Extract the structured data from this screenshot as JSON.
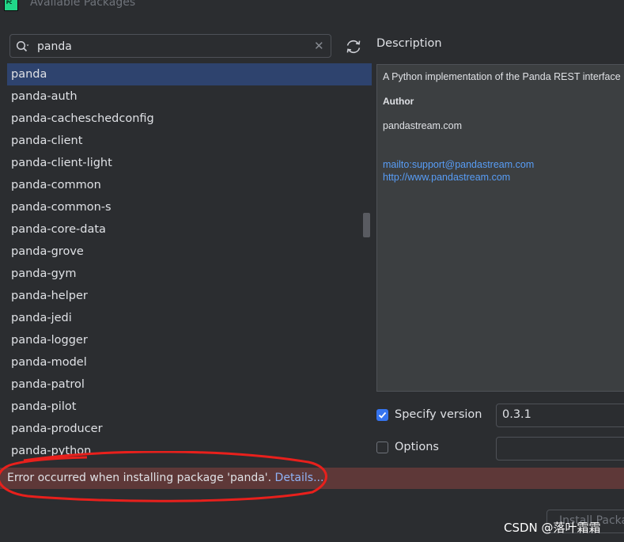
{
  "window": {
    "title": "Available Packages"
  },
  "search": {
    "value": "panda"
  },
  "packages": [
    "panda",
    "panda-auth",
    "panda-cacheschedconfig",
    "panda-client",
    "panda-client-light",
    "panda-common",
    "panda-common-s",
    "panda-core-data",
    "panda-grove",
    "panda-gym",
    "panda-helper",
    "panda-jedi",
    "panda-logger",
    "panda-model",
    "panda-patrol",
    "panda-pilot",
    "panda-producer",
    "panda-python"
  ],
  "description": {
    "label": "Description",
    "text": "A Python implementation of the Panda REST interface",
    "author_label": "Author",
    "author": "pandastream.com",
    "email_link": "mailto:support@pandastream.com",
    "web_link": "http://www.pandastream.com"
  },
  "version": {
    "label": "Specify version",
    "checked": true,
    "value": "0.3.1"
  },
  "options": {
    "label": "Options",
    "checked": false
  },
  "error": {
    "message": "Error occurred when installing package 'panda'. ",
    "details_label": "Details..."
  },
  "install_button": {
    "label": "Install Package"
  },
  "watermark": {
    "text": "CSDN @落叶霜霜"
  },
  "colors": {
    "accent": "#3574f0",
    "selection": "#2e436e",
    "error_bg": "#5e3838",
    "link": "#589df6",
    "annotation": "#e8201c"
  }
}
